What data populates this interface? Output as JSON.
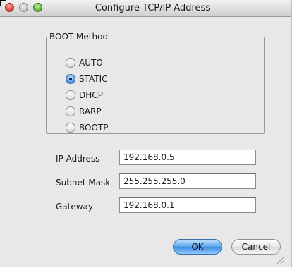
{
  "window": {
    "title": "Configure TCP/IP Address"
  },
  "boot_method": {
    "legend": "BOOT Method",
    "options": [
      {
        "label": "AUTO",
        "checked": false
      },
      {
        "label": "STATIC",
        "checked": true
      },
      {
        "label": "DHCP",
        "checked": false
      },
      {
        "label": "RARP",
        "checked": false
      },
      {
        "label": "BOOTP",
        "checked": false
      }
    ]
  },
  "fields": {
    "ip_address": {
      "label": "IP Address",
      "value": "192.168.0.5"
    },
    "subnet_mask": {
      "label": "Subnet Mask",
      "value": "255.255.255.0"
    },
    "gateway": {
      "label": "Gateway",
      "value": "192.168.0.1"
    }
  },
  "buttons": {
    "ok": "OK",
    "cancel": "Cancel"
  }
}
